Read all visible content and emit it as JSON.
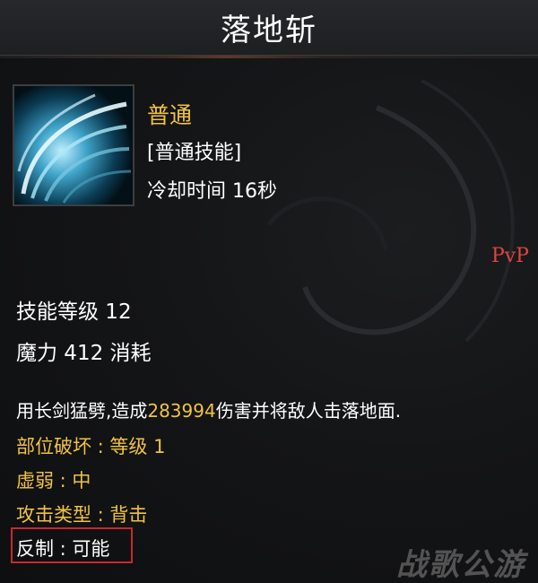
{
  "skill": {
    "name": "落地斩",
    "type": "普通",
    "category": "[普通技能]",
    "cooldown": "冷却时间 16秒",
    "pvp_badge": "PvP",
    "skill_level": "技能等级 12",
    "mana_cost": "魔力 412 消耗",
    "description": {
      "before": "用长剑猛劈,造成",
      "damage": "283994",
      "after": "伤害并将敌人击落地面."
    },
    "properties": [
      {
        "label": "部位破坏 : 等级 1"
      },
      {
        "label": "虚弱 : 中"
      },
      {
        "label": "攻击类型 : 背击"
      },
      {
        "label": "反制 : 可能"
      }
    ]
  },
  "watermark": "战歌公游",
  "colors": {
    "accent_gold": "#f0c244",
    "pvp_red": "#e0453f",
    "highlight_box": "#c9282e"
  },
  "icons": {
    "skill_icon": "sword-swirl-icon"
  }
}
